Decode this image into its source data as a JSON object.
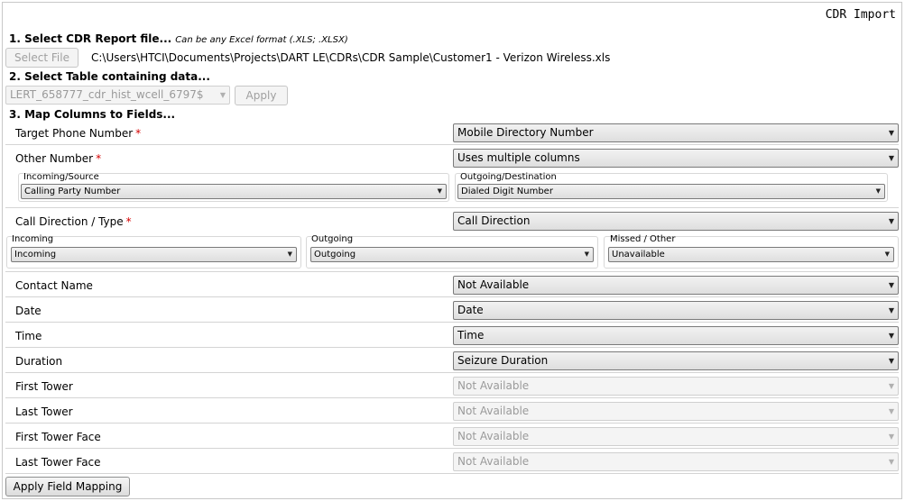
{
  "header": {
    "title": "CDR Import"
  },
  "step1": {
    "label": "1. Select CDR Report file...",
    "hint": "Can be any Excel format (.XLS; .XLSX)",
    "select_button": "Select File",
    "file_path": "C:\\Users\\HTCI\\Documents\\Projects\\DART LE\\CDRs\\CDR Sample\\Customer1 - Verizon Wireless.xls"
  },
  "step2": {
    "label": "2. Select Table containing data...",
    "table_value": "LERT_658777_cdr_hist_wcell_6797$",
    "apply_button": "Apply"
  },
  "step3": {
    "label": "3. Map Columns to Fields..."
  },
  "required_mark": "*",
  "fields": {
    "target_phone": {
      "label": "Target Phone Number",
      "value": "Mobile Directory Number"
    },
    "other_number": {
      "label": "Other Number",
      "value": "Uses multiple columns",
      "incoming_label": "Incoming/Source",
      "incoming_value": "Calling Party Number",
      "outgoing_label": "Outgoing/Destination",
      "outgoing_value": "Dialed Digit Number"
    },
    "call_direction": {
      "label": "Call Direction / Type",
      "value": "Call Direction",
      "incoming_label": "Incoming",
      "incoming_value": "Incoming",
      "outgoing_label": "Outgoing",
      "outgoing_value": "Outgoing",
      "missed_label": "Missed / Other",
      "missed_value": "Unavailable"
    },
    "contact_name": {
      "label": "Contact Name",
      "value": "Not Available"
    },
    "date": {
      "label": "Date",
      "value": "Date"
    },
    "time": {
      "label": "Time",
      "value": "Time"
    },
    "duration": {
      "label": "Duration",
      "value": "Seizure Duration"
    },
    "first_tower": {
      "label": "First Tower",
      "value": "Not Available"
    },
    "last_tower": {
      "label": "Last Tower",
      "value": "Not Available"
    },
    "first_tower_face": {
      "label": "First Tower Face",
      "value": "Not Available"
    },
    "last_tower_face": {
      "label": "Last Tower Face",
      "value": "Not Available"
    }
  },
  "footer": {
    "apply_mapping_button": "Apply Field Mapping"
  },
  "icons": {
    "dropdown": "chevron-down-icon"
  },
  "arrow_glyph": "▼"
}
